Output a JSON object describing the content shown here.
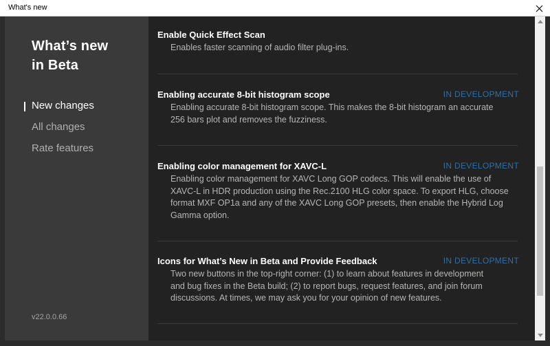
{
  "window": {
    "title": "What's new",
    "close_icon": "close-icon"
  },
  "sidebar": {
    "heading_line1": "What’s new",
    "heading_line2": "in Beta",
    "nav": [
      {
        "label": "New changes",
        "active": true
      },
      {
        "label": "All changes",
        "active": false
      },
      {
        "label": "Rate features",
        "active": false
      }
    ],
    "version": "v22.0.0.66"
  },
  "entries": [
    {
      "title": "Enable Quick Effect Scan",
      "badge": "",
      "description_lines": [
        "Enables faster scanning of audio filter plug-ins."
      ]
    },
    {
      "title": "Enabling accurate 8-bit histogram scope",
      "badge": "IN DEVELOPMENT",
      "description_lines": [
        "Enabling accurate 8-bit histogram scope. This makes the 8-bit histogram an accurate",
        "256 bars plot and removes the fuzziness."
      ]
    },
    {
      "title": "Enabling color management for XAVC-L",
      "badge": "IN DEVELOPMENT",
      "description_lines": [
        "Enabling color management for XAVC Long GOP codecs.  This will enable the use of",
        "XAVC-L in HDR production using the Rec.2100 HLG color space. To export HLG, choose",
        "format MXF OP1a and any of the XAVC Long GOP presets, then enable the Hybrid Log",
        "Gamma option."
      ]
    },
    {
      "title": "Icons for What’s New in Beta and Provide Feedback",
      "badge": "IN DEVELOPMENT",
      "description_lines": [
        "Two new buttons in the top-right corner: (1) to learn about features in development",
        "and bug fixes in the Beta build; (2) to report bugs, request features, and join forum",
        "discussions. At times, we may ask you for your opinion of new features."
      ]
    }
  ],
  "colors": {
    "badge": "#2f6fa8",
    "sidebar_bg": "#3a3a3a",
    "content_bg": "#222222"
  }
}
